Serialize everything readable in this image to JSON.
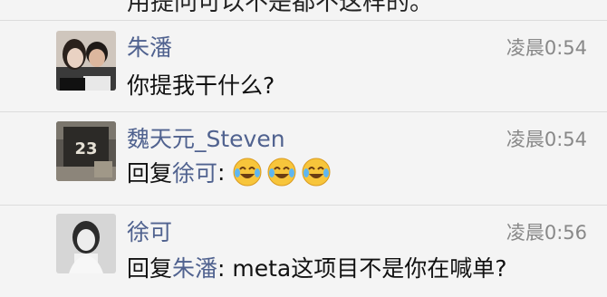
{
  "top_cutoff": {
    "text": "用提问可以不是都不这样的。"
  },
  "messages": [
    {
      "sender": "朱潘",
      "time": "凌晨0:54",
      "avatar": "couple-photo-avatar",
      "text": "你提我干什么?"
    },
    {
      "sender": "魏天元_Steven",
      "time": "凌晨0:54",
      "avatar": "jersey-23-avatar",
      "reply_prefix": "回复",
      "mention": "徐可",
      "colon": ":",
      "emojis": [
        "laughing-crying-emoji",
        "laughing-crying-emoji",
        "laughing-crying-emoji"
      ]
    },
    {
      "sender": "徐可",
      "time": "凌晨0:56",
      "avatar": "woman-portrait-avatar",
      "reply_prefix": "回复",
      "mention": "朱潘",
      "text": ": meta这项目不是你在喊单?"
    }
  ],
  "colors": {
    "name": "#50628f",
    "mention": "#50628f",
    "time": "#888888",
    "row_bg": "#f4f4f4",
    "divider": "#dcdcdc"
  }
}
